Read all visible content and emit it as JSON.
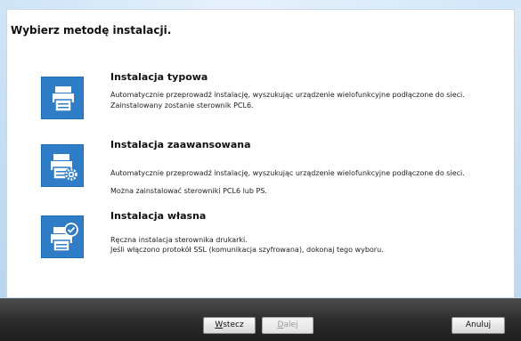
{
  "page": {
    "title": "Wybierz metodę instalacji."
  },
  "options": [
    {
      "title": "Instalacja typowa",
      "desc1": "Automatycznie przeprowadź instalację, wyszukując urządzenie wielofunkcyjne podłączone do sieci.",
      "desc2": "Zainstalowany zostanie sterownik PCL6.",
      "icon": "printer-icon"
    },
    {
      "title": "Instalacja zaawansowana",
      "desc1": "Automatycznie przeprowadź instalację, wyszukując urządzenie wielofunkcyjne podłączone do sieci.",
      "desc2": "Można zainstalować sterowniki PCL6 lub PS.",
      "icon": "printer-gear-icon"
    },
    {
      "title": "Instalacja własna",
      "desc1": "Ręczna instalacja sterownika drukarki.",
      "desc2": "Jeśli włączono protokół SSL (komunikacja szyfrowana), dokonaj tego wyboru.",
      "icon": "printer-check-icon"
    }
  ],
  "buttons": {
    "back": {
      "underline": "W",
      "rest": "stecz"
    },
    "next": {
      "underline": "D",
      "rest": "alej"
    },
    "cancel": "Anuluj"
  },
  "colors": {
    "accent": "#2e7dc6"
  }
}
